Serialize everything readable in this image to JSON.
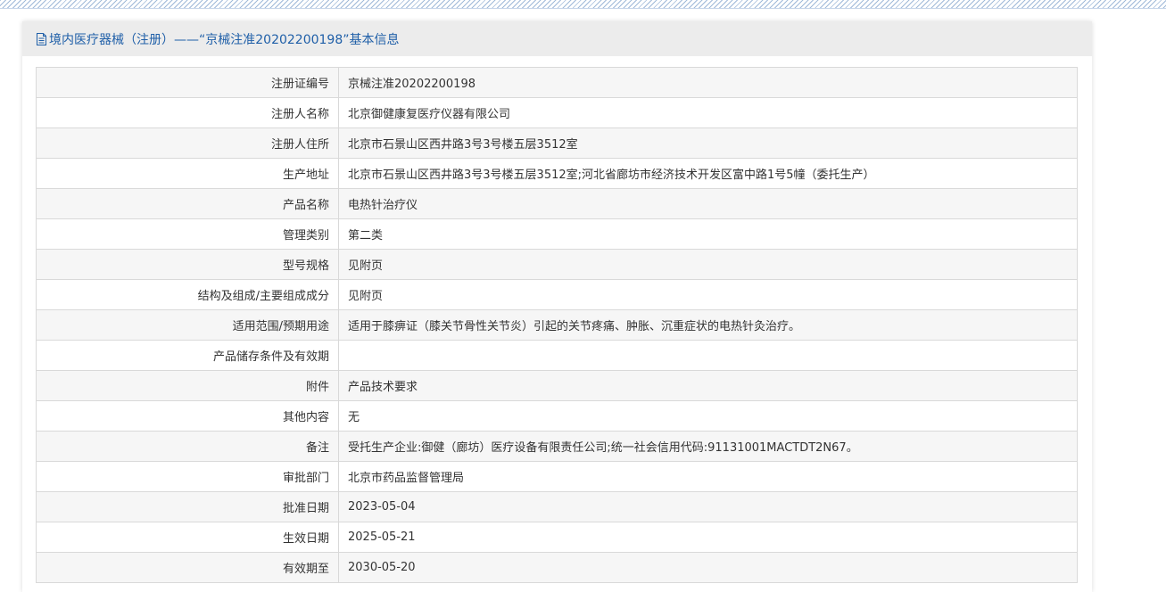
{
  "header": {
    "icon": "document-icon",
    "title": "境内医疗器械（注册）——“京械注准20202200198”基本信息"
  },
  "rows": [
    {
      "label": "注册证编号",
      "value": "京械注准20202200198"
    },
    {
      "label": "注册人名称",
      "value": "北京御健康复医疗仪器有限公司"
    },
    {
      "label": "注册人住所",
      "value": "北京市石景山区西井路3号3号楼五层3512室"
    },
    {
      "label": "生产地址",
      "value": "北京市石景山区西井路3号3号楼五层3512室;河北省廊坊市经济技术开发区富中路1号5幢（委托生产）"
    },
    {
      "label": "产品名称",
      "value": "电热针治疗仪"
    },
    {
      "label": "管理类别",
      "value": "第二类"
    },
    {
      "label": "型号规格",
      "value": "见附页"
    },
    {
      "label": "结构及组成/主要组成成分",
      "value": "见附页"
    },
    {
      "label": "适用范围/预期用途",
      "value": "适用于膝痹证（膝关节骨性关节炎）引起的关节疼痛、肿胀、沉重症状的电热针灸治疗。"
    },
    {
      "label": "产品储存条件及有效期",
      "value": ""
    },
    {
      "label": "附件",
      "value": "产品技术要求"
    },
    {
      "label": "其他内容",
      "value": "无"
    },
    {
      "label": "备注",
      "value": "受托生产企业:御健（廊坊）医疗设备有限责任公司;统一社会信用代码:91131001MACTDT2N67。"
    },
    {
      "label": "审批部门",
      "value": "北京市药品监督管理局"
    },
    {
      "label": "批准日期",
      "value": "2023-05-04"
    },
    {
      "label": "生效日期",
      "value": "2025-05-21"
    },
    {
      "label": "有效期至",
      "value": "2030-05-20"
    }
  ]
}
